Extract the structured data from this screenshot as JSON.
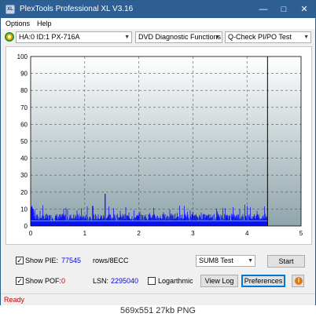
{
  "window": {
    "title": "PlexTools Professional XL V3.16",
    "icon_text": "XL"
  },
  "menubar": {
    "items": [
      "Options",
      "Help"
    ]
  },
  "toolbar": {
    "drive": "HA:0 ID:1  PX-716A",
    "function": "DVD Diagnostic Functions",
    "test": "Q-Check PI/PO Test"
  },
  "chart_data": {
    "type": "bar",
    "x_ticks": [
      "0",
      "1",
      "2",
      "3",
      "4",
      "5"
    ],
    "y_ticks": [
      "0",
      "10",
      "20",
      "30",
      "40",
      "50",
      "60",
      "70",
      "80",
      "90",
      "100"
    ],
    "xlim": [
      0,
      5
    ],
    "ylim": [
      0,
      100
    ],
    "grid": true,
    "end_marker_x": 4.38,
    "series": [
      {
        "type": "bar",
        "color": "#0000ff",
        "x_start": 0,
        "x_end": 4.38,
        "typical": 6,
        "peak": 19,
        "peak_x": 1.38
      },
      {
        "type": "line",
        "color": "#00e000",
        "x_start": 0,
        "x_end": 4.38,
        "value": 3
      }
    ]
  },
  "bottom": {
    "show_pie_label": "Show PIE:",
    "pie_value": "77545",
    "pie_unit": "rows/8ECC",
    "show_pof_label": "Show POF:",
    "pof_value": "0",
    "lsn_label": "LSN:",
    "lsn_value": "2295040",
    "logarithmic_label": "Logarthmic",
    "sum_select": "SUM8 Test",
    "start_button": "Start",
    "view_log_button": "View Log",
    "preferences_button": "Preferences",
    "info_icon_text": "i",
    "checked_mark": "✓"
  },
  "status": {
    "text": "Ready"
  },
  "caption": "569x551  27kb  PNG",
  "colors": {
    "title_bar": "#2d5f95",
    "status_red": "#d00000",
    "pie_blue": "#0000ff",
    "pof_red": "#d00000"
  }
}
